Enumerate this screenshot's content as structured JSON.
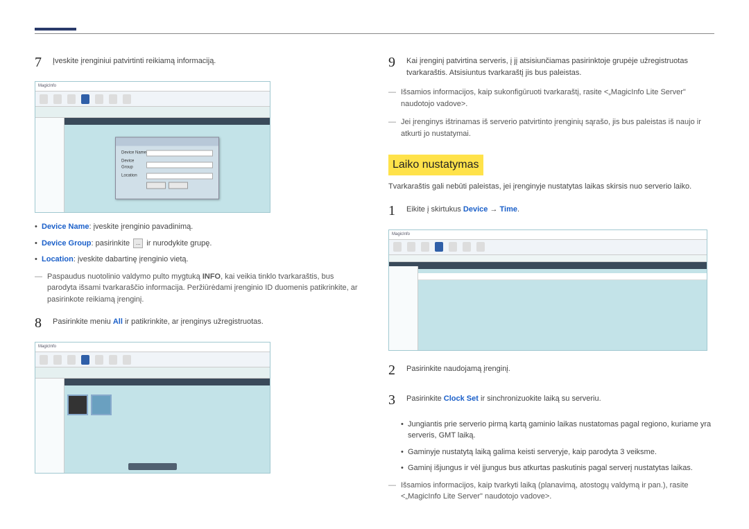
{
  "left": {
    "step7": {
      "num": "7",
      "text": "Įveskite įrenginiui patvirtinti reikiamą informaciją."
    },
    "bullets": {
      "b1_term": "Device Name",
      "b1_text": ": įveskite įrenginio pavadinimą.",
      "b2_term": "Device Group",
      "b2_text_a": ": pasirinkite ",
      "b2_text_b": " ir nurodykite grupę.",
      "b3_term": "Location",
      "b3_text": ": įveskite dabartinę įrenginio vietą."
    },
    "note7_a": "Paspaudus nuotolinio valdymo pulto mygtuką ",
    "note7_b": "INFO",
    "note7_c": ", kai veikia tinklo tvarkaraštis, bus parodyta išsami tvarkaraščio informacija. Peržiūrėdami įrenginio ID duomenis patikrinkite, ar pasirinkote reikiamą įrenginį.",
    "step8": {
      "num": "8",
      "text_a": "Pasirinkite meniu ",
      "text_b": "All",
      "text_c": " ir patikrinkite, ar įrenginys užregistruotas."
    }
  },
  "right": {
    "step9": {
      "num": "9",
      "text": "Kai įrenginį patvirtina serveris, į jį atsisiunčiamas pasirinktoje grupėje užregistruotas tvarkaraštis. Atsisiuntus tvarkaraštį jis bus paleistas."
    },
    "note9a": "Išsamios informacijos, kaip sukonfigūruoti tvarkaraštį, rasite <„MagicInfo Lite Server\" naudotojo vadove>.",
    "note9b": "Jei įrenginys ištrinamas iš serverio patvirtinto įrenginių sąrašo, jis bus paleistas iš naujo ir atkurti jo nustatymai.",
    "heading": "Laiko nustatymas",
    "intro": "Tvarkaraštis gali nebūti paleistas, jei įrenginyje nustatytas laikas skirsis nuo serverio laiko.",
    "step1": {
      "num": "1",
      "text_a": "Eikite į skirtukus ",
      "text_b": "Device",
      "text_c": " → ",
      "text_d": "Time",
      "text_e": "."
    },
    "step2": {
      "num": "2",
      "text": "Pasirinkite naudojamą įrenginį."
    },
    "step3": {
      "num": "3",
      "text_a": "Pasirinkite ",
      "text_b": "Clock Set",
      "text_c": " ir sinchronizuokite laiką su serveriu."
    },
    "sub_bullets": {
      "a": "Jungiantis prie serverio pirmą kartą gaminio laikas nustatomas pagal regiono, kuriame yra serveris, GMT laiką.",
      "b": "Gaminyje nustatytą laiką galima keisti serveryje, kaip parodyta 3 veiksme.",
      "c": "Gaminį išjungus ir vėl įjungus bus atkurtas paskutinis pagal serverį nustatytas laikas."
    },
    "bottom_note": "Išsamios informacijos, kaip tvarkyti laiką (planavimą, atostogų valdymą ir pan.), rasite <„MagicInfo Lite Server\" naudotojo vadove>."
  },
  "shot_logo": "MagicInfo",
  "ellipsis": "..."
}
